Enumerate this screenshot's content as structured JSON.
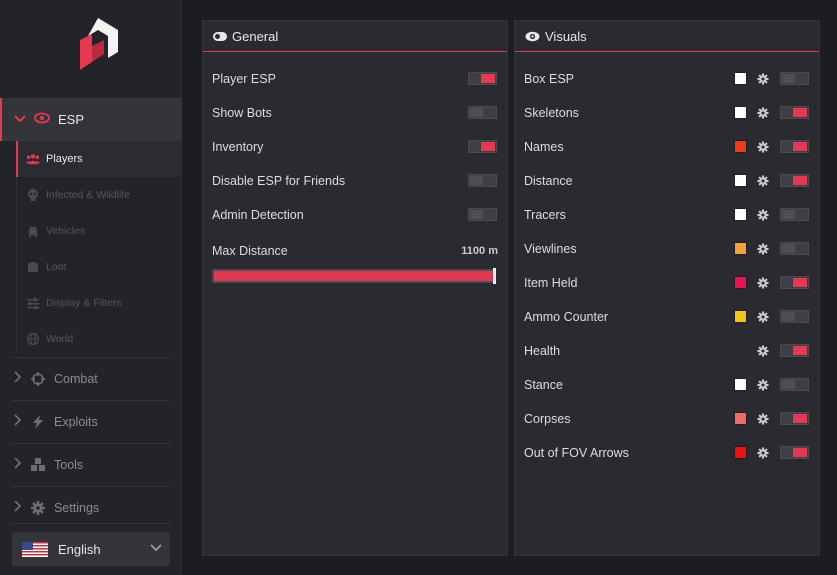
{
  "sidebar": {
    "active_section": {
      "label": "ESP",
      "icon": "eye-icon"
    },
    "subitems": [
      {
        "label": "Players",
        "icon": "users-icon",
        "active": true
      },
      {
        "label": "Infected & Wildlife",
        "icon": "skull-icon",
        "active": false
      },
      {
        "label": "Vehicles",
        "icon": "car-icon",
        "active": false
      },
      {
        "label": "Loot",
        "icon": "box-icon",
        "active": false
      },
      {
        "label": "Display & Filters",
        "icon": "sliders-icon",
        "active": false
      },
      {
        "label": "World",
        "icon": "globe-icon",
        "active": false
      }
    ],
    "sections": [
      {
        "label": "Combat",
        "icon": "crosshair-icon"
      },
      {
        "label": "Exploits",
        "icon": "bolt-icon"
      },
      {
        "label": "Tools",
        "icon": "cubes-icon"
      },
      {
        "label": "Settings",
        "icon": "gear-icon"
      }
    ],
    "language": {
      "label": "English",
      "flag": "us-flag-icon"
    }
  },
  "general": {
    "title": "General",
    "icon": "toggle-icon",
    "rows": [
      {
        "label": "Player ESP",
        "on": true
      },
      {
        "label": "Show Bots",
        "on": false
      },
      {
        "label": "Inventory",
        "on": true
      },
      {
        "label": "Disable ESP for Friends",
        "on": false
      },
      {
        "label": "Admin Detection",
        "on": false
      }
    ],
    "max_distance": {
      "label": "Max Distance",
      "value_text": "1100 m",
      "fill_fraction": 1.0
    }
  },
  "visuals": {
    "title": "Visuals",
    "icon": "eye-icon",
    "rows": [
      {
        "label": "Box ESP",
        "color": "#ffffff",
        "on": false
      },
      {
        "label": "Skeletons",
        "color": "#ffffff",
        "on": true
      },
      {
        "label": "Names",
        "color": "#f03a1a",
        "on": true
      },
      {
        "label": "Distance",
        "color": "#ffffff",
        "on": true
      },
      {
        "label": "Tracers",
        "color": "#ffffff",
        "on": false
      },
      {
        "label": "Viewlines",
        "color": "#f5a23a",
        "on": false
      },
      {
        "label": "Item Held",
        "color": "#ea1450",
        "on": true
      },
      {
        "label": "Ammo Counter",
        "color": "#f5c21a",
        "on": false
      },
      {
        "label": "Health",
        "color": null,
        "on": true
      },
      {
        "label": "Stance",
        "color": "#ffffff",
        "on": false
      },
      {
        "label": "Corpses",
        "color": "#f06a6a",
        "on": true
      },
      {
        "label": "Out of FOV Arrows",
        "color": "#f01010",
        "on": true
      }
    ]
  },
  "colors": {
    "accent": "#e8384f",
    "panel": "#2a2b30",
    "background": "#1c1d22"
  }
}
